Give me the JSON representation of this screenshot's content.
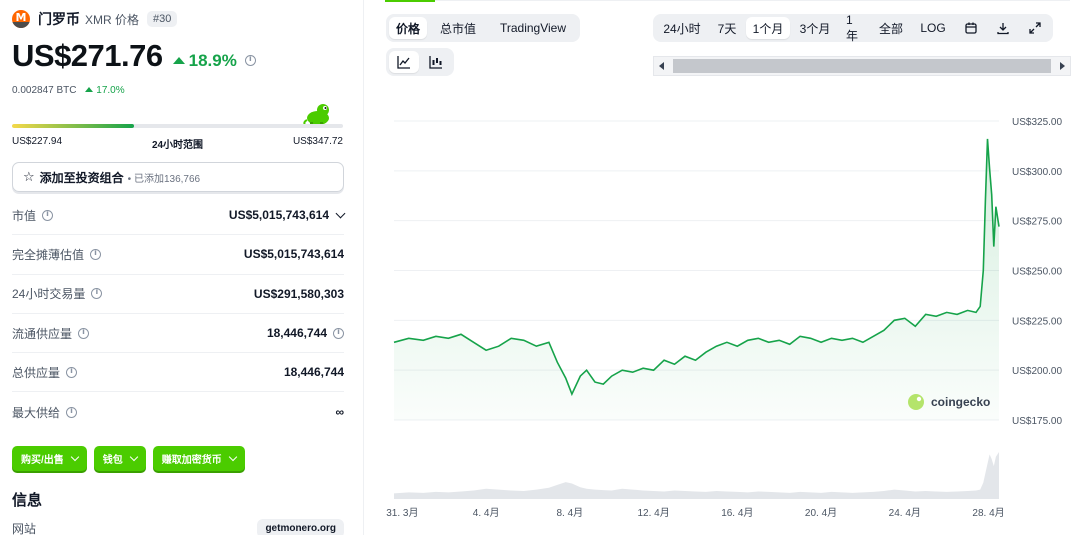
{
  "coin": {
    "name": "门罗币",
    "subtitle": "XMR 价格",
    "rank": "#30",
    "price": "US$271.76",
    "change_24h": "18.9%",
    "btc_price": "0.002847 BTC",
    "btc_change": "17.0%"
  },
  "range_24h": {
    "low": "US$227.94",
    "label": "24小时范围",
    "high": "US$347.72",
    "position": 0.37
  },
  "portfolio": {
    "label": "添加至投资组合",
    "count": "• 已添加136,766"
  },
  "stats": [
    {
      "label": "市值",
      "value": "US$5,015,743,614"
    },
    {
      "label": "完全摊薄估值",
      "value": "US$5,015,743,614"
    },
    {
      "label": "24小时交易量",
      "value": "US$291,580,303"
    },
    {
      "label": "流通供应量",
      "value": "18,446,744"
    },
    {
      "label": "总供应量",
      "value": "18,446,744"
    },
    {
      "label": "最大供给",
      "value": "∞"
    }
  ],
  "actions": [
    {
      "label": "购买/出售"
    },
    {
      "label": "钱包"
    },
    {
      "label": "赚取加密货币"
    }
  ],
  "info": {
    "heading": "信息",
    "website_label": "网站",
    "website_value": "getmonero.org"
  },
  "chart_tabs": [
    "价格",
    "总市值",
    "TradingView"
  ],
  "time_ranges": [
    "24小时",
    "7天",
    "1个月",
    "3个月",
    "1年",
    "全部",
    "LOG"
  ],
  "active_time_range": "1个月",
  "colors": {
    "accent": "#4bcc00",
    "up": "#16a34a",
    "line": "#16a34a",
    "monero": "#ff6600"
  },
  "watermark": "coingecko",
  "chart_data": {
    "type": "line",
    "title": "",
    "xlabel": "",
    "ylabel": "",
    "ylim": [
      175,
      325
    ],
    "y_ticks": [
      "US$325.00",
      "US$300.00",
      "US$275.00",
      "US$250.00",
      "US$225.00",
      "US$200.00",
      "US$175.00"
    ],
    "y_tick_values": [
      325,
      300,
      275,
      250,
      225,
      200,
      175
    ],
    "x_ticks": [
      "31. 3月",
      "4. 4月",
      "8. 4月",
      "12. 4月",
      "16. 4月",
      "20. 4月",
      "24. 4月",
      "28. 4月"
    ],
    "x_tick_days": [
      0,
      4,
      8,
      12,
      16,
      20,
      24,
      28
    ],
    "xlim_days": [
      -0.4,
      28.5
    ],
    "series": [
      {
        "x_days": [
          -0.4,
          0.3,
          1.0,
          1.6,
          2.2,
          2.8,
          3.4,
          4.0,
          4.6,
          5.2,
          5.8,
          6.4,
          7.0,
          7.4,
          7.8,
          8.1,
          8.5,
          8.8,
          9.2,
          9.6,
          10.0,
          10.5,
          11.0,
          11.5,
          12.0,
          12.5,
          13.0,
          13.5,
          14.0,
          14.5,
          15.0,
          15.5,
          16.0,
          16.5,
          17.0,
          17.5,
          18.0,
          18.5,
          19.0,
          19.5,
          20.0,
          20.5,
          21.0,
          21.5,
          22.0,
          22.5,
          23.0,
          23.5,
          24.0,
          24.5,
          25.0,
          25.5,
          26.0,
          26.5,
          27.0,
          27.4,
          27.6,
          27.75,
          27.85,
          27.95,
          28.05,
          28.15,
          28.25,
          28.35,
          28.5
        ],
        "y": [
          214,
          216,
          215,
          217,
          216,
          218,
          214,
          210,
          212,
          216,
          215,
          212,
          214,
          204,
          196,
          188,
          197,
          200,
          194,
          193,
          197,
          200,
          199,
          201,
          200,
          205,
          203,
          207,
          205,
          209,
          212,
          214,
          212,
          215,
          216,
          214,
          215,
          213,
          217,
          216,
          214,
          216,
          215,
          216,
          214,
          217,
          220,
          225,
          226,
          222,
          228,
          227,
          229,
          228,
          230,
          229,
          232,
          250,
          285,
          316,
          301,
          288,
          262,
          282,
          272
        ],
        "volume": [
          0.12,
          0.14,
          0.13,
          0.15,
          0.14,
          0.16,
          0.18,
          0.22,
          0.2,
          0.18,
          0.17,
          0.2,
          0.24,
          0.3,
          0.36,
          0.33,
          0.25,
          0.22,
          0.2,
          0.19,
          0.18,
          0.22,
          0.2,
          0.18,
          0.17,
          0.16,
          0.18,
          0.17,
          0.16,
          0.15,
          0.17,
          0.16,
          0.15,
          0.14,
          0.16,
          0.15,
          0.14,
          0.13,
          0.15,
          0.14,
          0.13,
          0.15,
          0.14,
          0.13,
          0.14,
          0.15,
          0.17,
          0.2,
          0.18,
          0.16,
          0.17,
          0.16,
          0.15,
          0.16,
          0.17,
          0.18,
          0.2,
          0.35,
          0.55,
          0.75,
          0.95,
          0.85,
          0.7,
          0.9,
          1.0
        ]
      }
    ],
    "grid": true
  }
}
